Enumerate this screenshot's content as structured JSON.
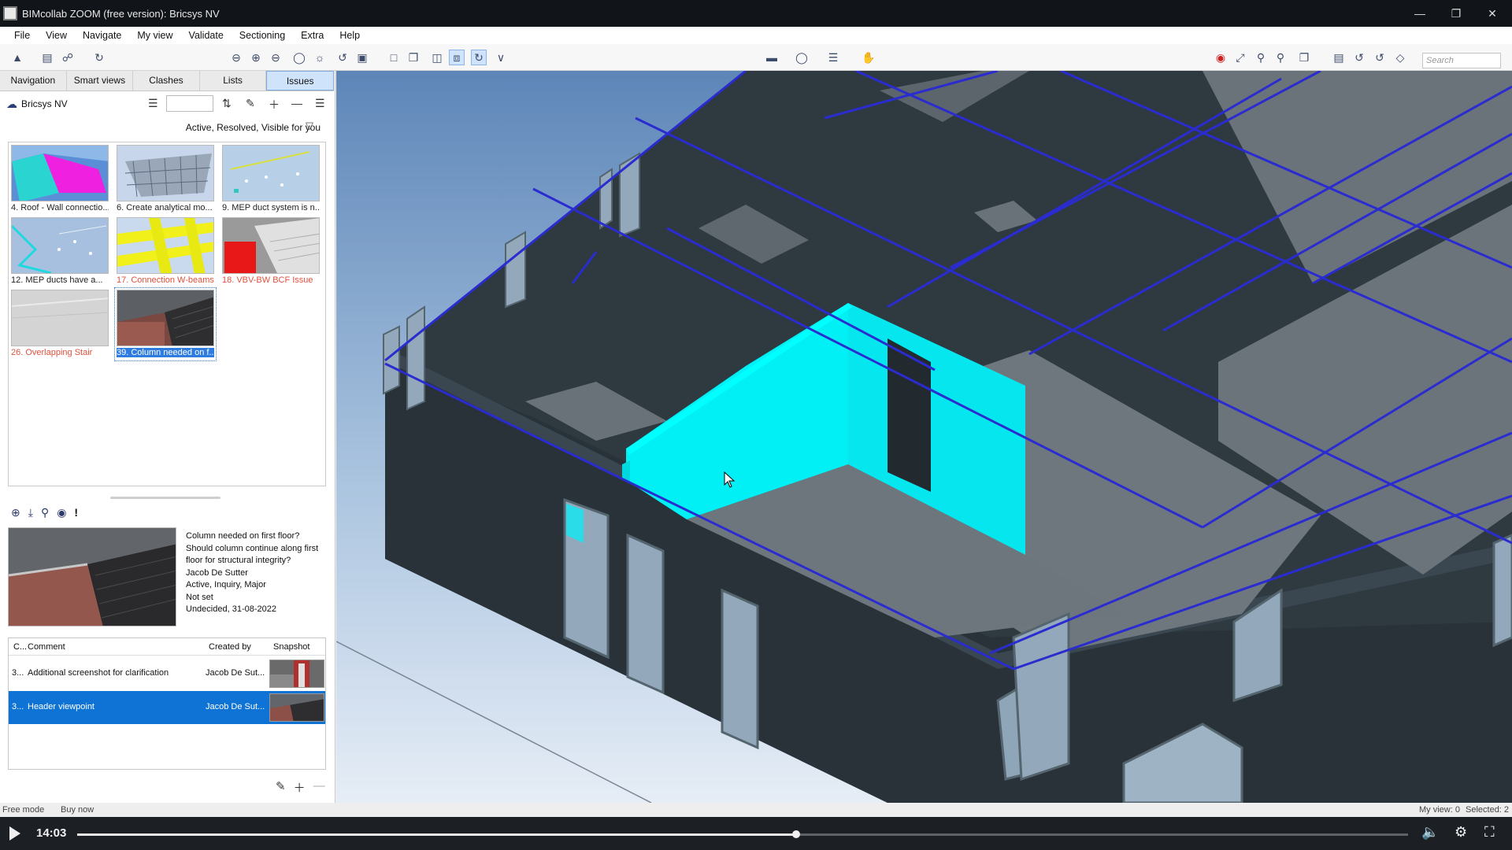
{
  "window": {
    "title": "BIMcollab ZOOM (free version): Bricsys NV"
  },
  "menu": [
    "File",
    "View",
    "Navigate",
    "My view",
    "Validate",
    "Sectioning",
    "Extra",
    "Help"
  ],
  "search": {
    "placeholder": "Search"
  },
  "tabs": [
    "Navigation",
    "Smart views",
    "Clashes",
    "Lists",
    "Issues"
  ],
  "active_tab": "Issues",
  "project": {
    "name": "Bricsys NV"
  },
  "filter_text": "Active, Resolved, Visible for you",
  "issues": [
    {
      "label": "4. Roof - Wall connectio...",
      "color": "normal"
    },
    {
      "label": "6. Create analytical mo...",
      "color": "normal"
    },
    {
      "label": "9. MEP duct system is n...",
      "color": "normal"
    },
    {
      "label": "12. MEP ducts have a...",
      "color": "normal"
    },
    {
      "label": "17. Connection W-beams",
      "color": "red"
    },
    {
      "label": "18. VBV-BW BCF Issue",
      "color": "red"
    },
    {
      "label": "26. Overlapping Stair",
      "color": "red"
    },
    {
      "label": "39. Column needed on f...",
      "color": "selected"
    }
  ],
  "issue_details": [
    "Column needed on first floor?",
    "Should column continue along first floor for structural integrity?",
    "Jacob De Sutter",
    "Active, Inquiry, Major",
    "Not set",
    "Undecided, 31-08-2022"
  ],
  "comments": {
    "headers": [
      "C...",
      "Comment",
      "Created by",
      "Snapshot"
    ],
    "rows": [
      {
        "c": "3...",
        "comment": "Additional screenshot for clarification",
        "created_by": "Jacob De Sut..."
      },
      {
        "c": "3...",
        "comment": "Header viewpoint",
        "created_by": "Jacob De Sut..."
      }
    ]
  },
  "status": {
    "mode": "Free mode",
    "buy": "Buy now",
    "myview": "My view: 0",
    "selected": "Selected: 2"
  },
  "video": {
    "time": "14:03",
    "progress": 0.54
  },
  "colors": {
    "accent": "#0f73d6",
    "highlight_wall": "#00e5f0",
    "wall_dark": "#2f3a40",
    "edge_blue": "#2626c8"
  },
  "icons": [
    "window-restore-icon",
    "minimize-icon",
    "close-icon",
    "cloud-icon",
    "list-icon",
    "sort-icon",
    "edit-icon",
    "add-icon",
    "remove-icon",
    "menu-icon",
    "filter-icon",
    "zoom-to-icon",
    "download-icon",
    "comment-icon",
    "camera-icon",
    "exclamation-icon",
    "play-icon",
    "volume-icon",
    "settings-icon",
    "fullscreen-icon"
  ]
}
